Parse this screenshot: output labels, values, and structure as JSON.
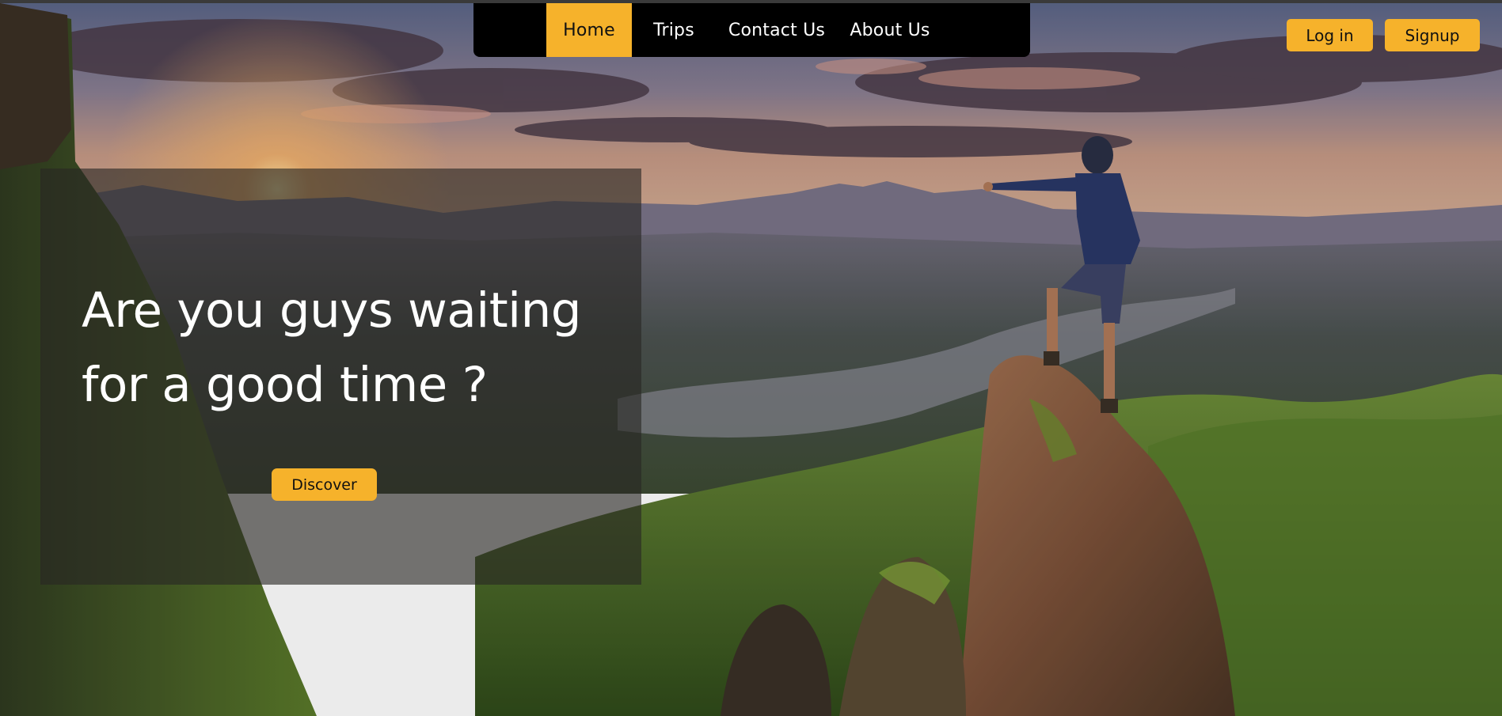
{
  "nav": {
    "items": [
      {
        "label": "Home",
        "active": true
      },
      {
        "label": "Trips",
        "active": false
      },
      {
        "label": "Contact Us",
        "active": false
      },
      {
        "label": "About Us",
        "active": false
      }
    ]
  },
  "auth": {
    "login_label": "Log in",
    "signup_label": "Signup"
  },
  "hero": {
    "title": "Are you guys waiting for a good time ?",
    "cta_label": "Discover"
  },
  "colors": {
    "accent": "#f6b22b",
    "nav_background": "#000000",
    "panel_overlay": "rgba(40,38,36,0.62)"
  },
  "background": {
    "image_icon": "mountain-landscape-photo"
  }
}
